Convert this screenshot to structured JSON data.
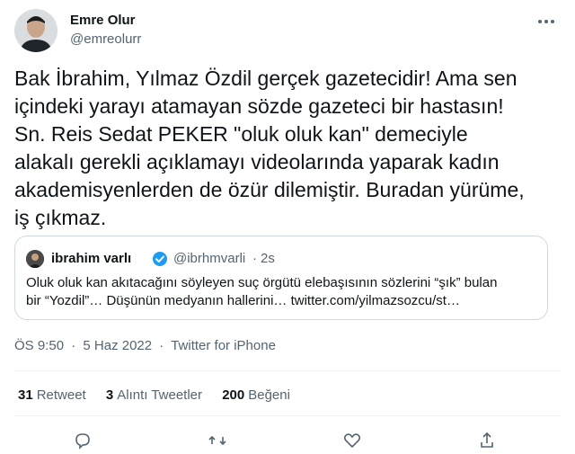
{
  "author": {
    "name": "Emre Olur",
    "handle": "@emreolurr"
  },
  "tweet": {
    "text": "Bak İbrahim, Yılmaz Özdil gerçek gazetecidir! Ama sen\niçindeki yarayı atamayan sözde gazeteci bir hastasın!\nSn. Reis Sedat PEKER \"oluk oluk kan\" demeciyle\nalakalı gerekli açıklamayı videolarında yaparak kadın\nakademisyenlerden de özür dilemiştir. Buradan yürüme,\niş çıkmaz."
  },
  "quote": {
    "name": "ibrahim varlı",
    "handle": "@ibrhmvarli",
    "separator": "·",
    "time": "2s",
    "text": "Oluk oluk kan akıtacağını söyleyen suç örgütü elebaşısının sözlerini “şık” bulan\nbir “Yozdil”… Düşünün medyanın hallerini… twitter.com/yilmazsozcu/st…"
  },
  "meta": {
    "time": "ÖS 9:50",
    "sep1": "·",
    "date": "5 Haz 2022",
    "sep2": "·",
    "source": "Twitter for iPhone"
  },
  "stats": {
    "retweets_count": "31",
    "retweets_label": "Retweet",
    "quotes_count": "3",
    "quotes_label": "Alıntı Tweetler",
    "likes_count": "200",
    "likes_label": "Beğeni"
  },
  "icons": {
    "more": "more-dots-icon",
    "verified": "verified-badge-icon",
    "actions": [
      "reply-icon",
      "retweet-icon",
      "like-icon",
      "share-icon"
    ]
  },
  "colors": {
    "text": "#0f1419",
    "secondary": "#536471",
    "border": "#cfd9de",
    "verified": "#1d9bf0"
  }
}
